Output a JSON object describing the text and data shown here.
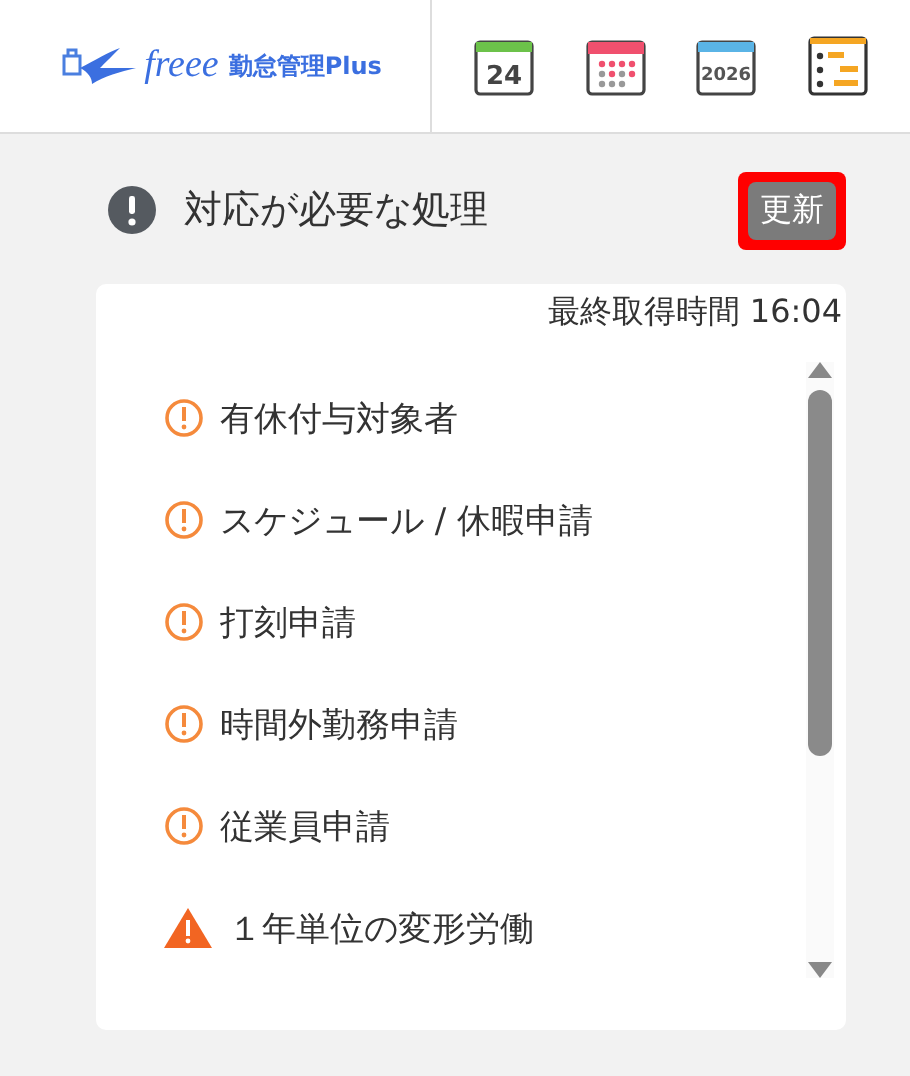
{
  "header": {
    "logo_brand": "freee",
    "logo_product": "勤怠管理Plus",
    "tools": [
      {
        "kind": "day",
        "label": "24"
      },
      {
        "kind": "month"
      },
      {
        "kind": "year",
        "label": "2026"
      },
      {
        "kind": "gantt"
      }
    ]
  },
  "section": {
    "title": "対応が必要な処理",
    "refresh_button": "更新",
    "refresh_highlighted": true,
    "last_fetched": "最終取得時間 16:04"
  },
  "items": [
    {
      "kind": "info",
      "label": "有休付与対象者"
    },
    {
      "kind": "info",
      "label": "スケジュール / 休暇申請"
    },
    {
      "kind": "info",
      "label": "打刻申請"
    },
    {
      "kind": "info",
      "label": "時間外勤務申請"
    },
    {
      "kind": "info",
      "label": "従業員申請"
    },
    {
      "kind": "warning",
      "label": "１年単位の変形労働"
    }
  ]
}
